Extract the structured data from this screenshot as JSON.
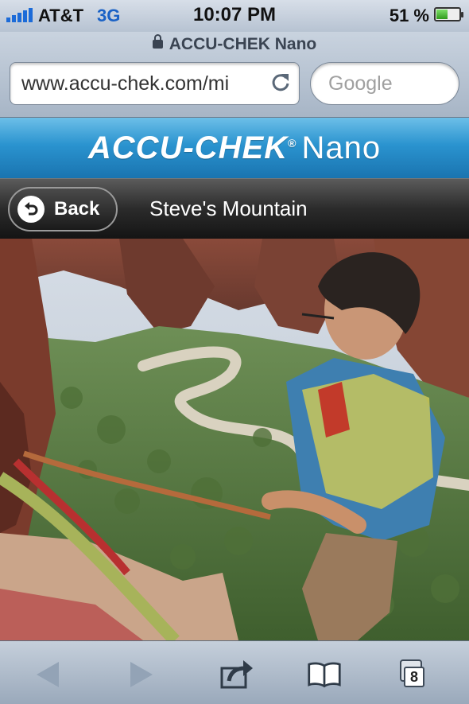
{
  "status_bar": {
    "carrier": "AT&T",
    "network": "3G",
    "time": "10:07 PM",
    "battery_percent": "51 %",
    "battery_level": 0.51,
    "signal_bars": 5
  },
  "browser": {
    "page_title": "ACCU-CHEK Nano",
    "url": "www.accu-chek.com/mi",
    "search_placeholder": "Google"
  },
  "brand": {
    "name": "ACCU-CHEK",
    "registered": "®",
    "product": "Nano"
  },
  "nav": {
    "back_label": "Back",
    "title": "Steve's Mountain"
  },
  "toolbar": {
    "tabs_count": "8",
    "icons": [
      "back-arrow-icon",
      "forward-arrow-icon",
      "share-icon",
      "bookmarks-icon",
      "tabs-icon"
    ]
  },
  "colors": {
    "brand_blue": "#2a93cf",
    "network_blue": "#1a62c6"
  }
}
